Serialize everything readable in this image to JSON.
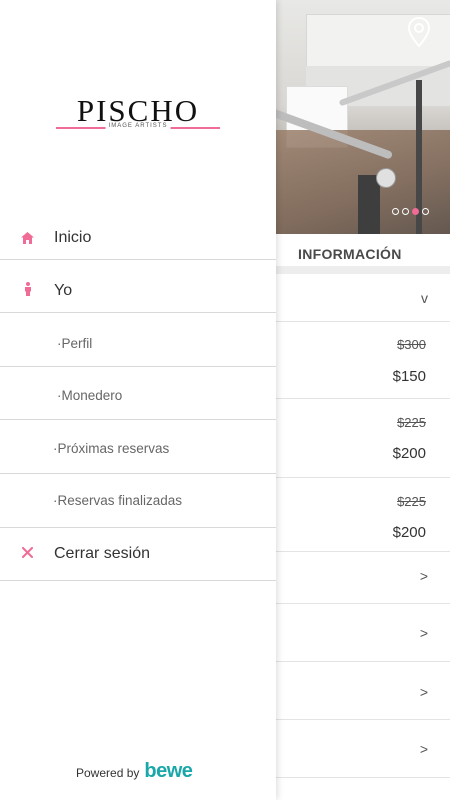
{
  "drawer": {
    "logo_main": "PISCHO",
    "logo_sub": "IMAGE ARTISTS",
    "items": [
      {
        "label": "Inicio"
      },
      {
        "label": "Yo"
      },
      {
        "label": "·Perfil"
      },
      {
        "label": "·Monedero"
      },
      {
        "label": "·Próximas reservas"
      },
      {
        "label": "·Reservas finalizadas"
      },
      {
        "label": "Cerrar sesión"
      }
    ],
    "powered_by": "Powered by",
    "powered_brand": "bewe"
  },
  "background": {
    "carousel": {
      "pages": 4,
      "active_index": 2
    },
    "section_title": "INFORMACIÓN",
    "expand_chevron": "v",
    "prices": [
      {
        "old": "$300",
        "new": "$150"
      },
      {
        "old": "$225",
        "new": "$200"
      },
      {
        "old": "$225",
        "new": "$200"
      }
    ],
    "row_chevron": ">"
  },
  "colors": {
    "accent": "#f06b95",
    "brand": "#1aa7a9",
    "divider": "#d9d9d9"
  },
  "icons": {
    "inicio": "home-icon",
    "yo": "person-icon",
    "cerrar": "close-icon",
    "hero": "location-pin-icon"
  }
}
